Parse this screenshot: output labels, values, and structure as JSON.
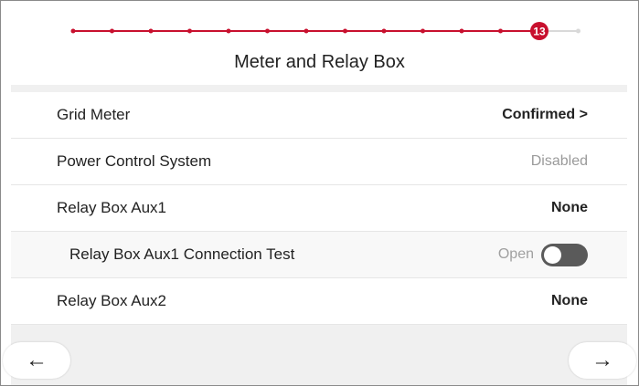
{
  "stepper": {
    "current_step": "13",
    "total_steps": 14,
    "accent_color": "#c8102e",
    "inactive_color": "#d9d9d9"
  },
  "page": {
    "title": "Meter and Relay Box"
  },
  "rows": [
    {
      "label": "Grid Meter",
      "value": "Confirmed >"
    },
    {
      "label": "Power Control System",
      "value": "Disabled"
    },
    {
      "label": "Relay Box Aux1",
      "value": "None"
    },
    {
      "label": "Relay Box Aux1 Connection Test",
      "toggle_label": "Open",
      "toggle_on": false
    },
    {
      "label": "Relay Box Aux2",
      "value": "None"
    }
  ],
  "nav": {
    "back_icon": "arrow-left-icon",
    "back_glyph": "←",
    "next_icon": "arrow-right-icon",
    "next_glyph": "→"
  }
}
